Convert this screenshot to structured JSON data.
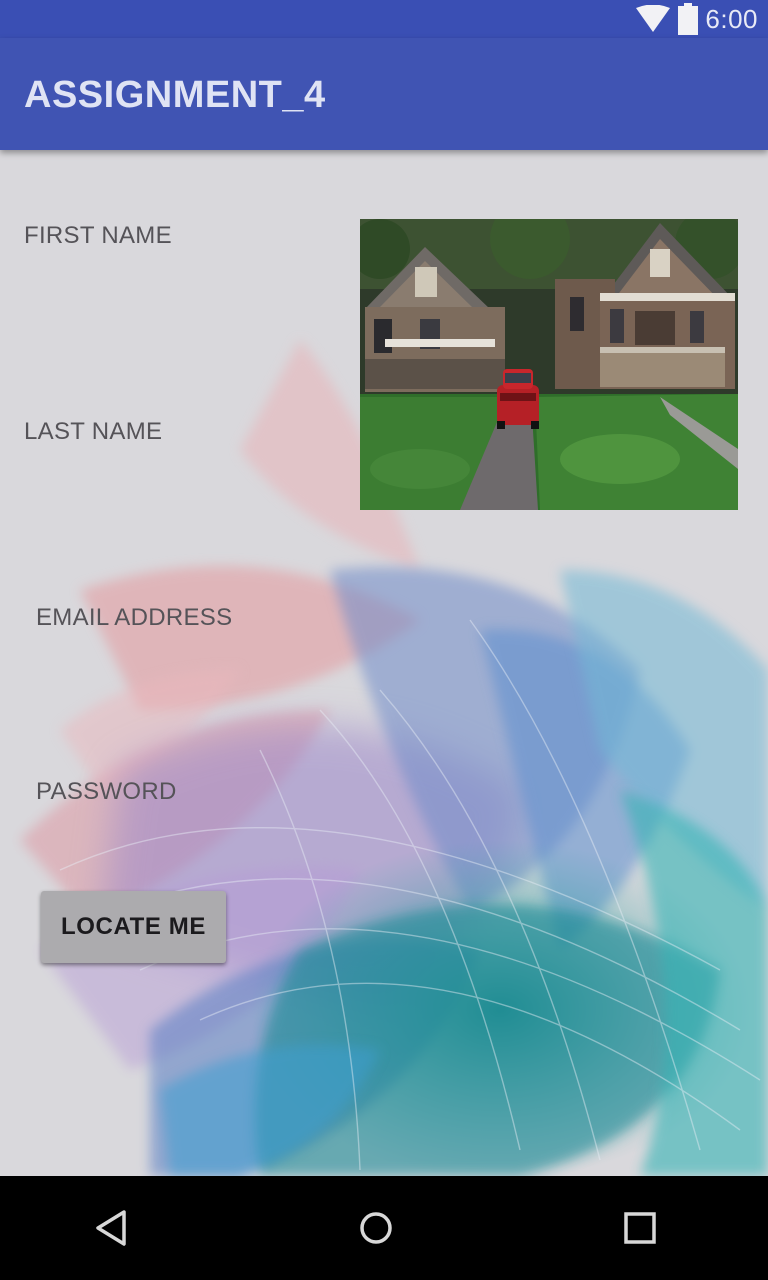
{
  "status_bar": {
    "time": "6:00",
    "icons": [
      "wifi-icon",
      "battery-icon"
    ]
  },
  "app_bar": {
    "title": "ASSIGNMENT_4",
    "color": "#4054b3"
  },
  "form": {
    "first_name_label": "FIRST NAME",
    "last_name_label": "LAST NAME",
    "email_label": "EMAIL ADDRESS",
    "password_label": "PASSWORD",
    "locate_button_label": "LOCATE ME"
  },
  "image": {
    "subject": "house-with-red-car-photo"
  },
  "nav_bar": {
    "icons": [
      "back-icon",
      "home-icon",
      "recent-apps-icon"
    ]
  }
}
